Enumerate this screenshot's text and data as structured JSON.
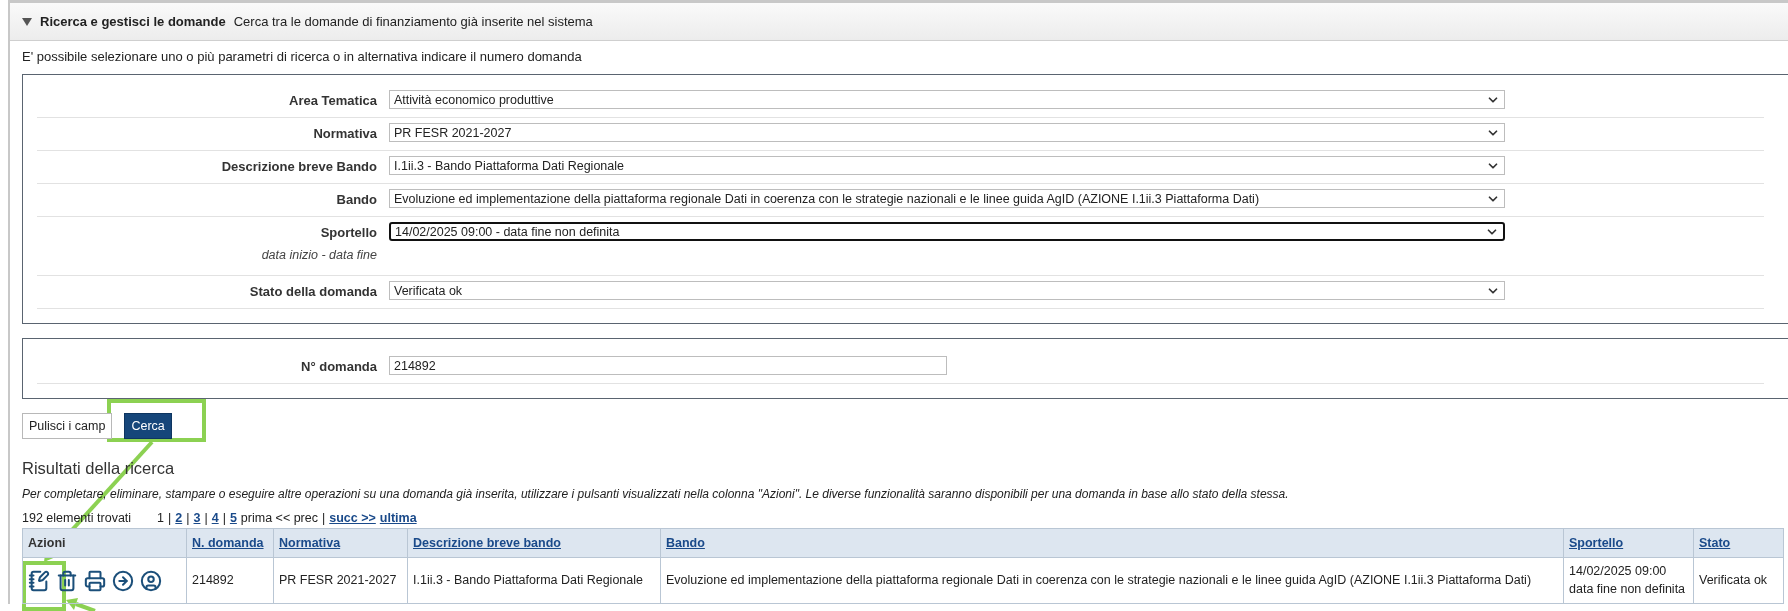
{
  "header": {
    "title": "Ricerca e gestisci le domande",
    "subtitle": "Cerca tra le domande di finanziamento già inserite nel sistema",
    "expanded": true
  },
  "intro": "E' possibile selezionare uno o più parametri di ricerca o in alternativa indicare il numero domanda",
  "filters": [
    {
      "label": "Area Tematica",
      "value": "Attività economico produttive",
      "focused": false
    },
    {
      "label": "Normativa",
      "value": "PR FESR 2021-2027",
      "focused": false
    },
    {
      "label": "Descrizione breve Bando",
      "value": "I.1ii.3 - Bando Piattaforma Dati Regionale",
      "focused": false
    },
    {
      "label": "Bando",
      "value": "Evoluzione ed implementazione della piattaforma regionale Dati in coerenza con le strategie nazionali e le linee guida AgID (AZIONE I.1ii.3 Piattaforma Dati)",
      "focused": false
    },
    {
      "label": "Sportello",
      "hint": "data inizio - data fine",
      "value": "14/02/2025 09:00 - data fine non definita",
      "focused": true
    },
    {
      "label": "Stato della domanda",
      "value": "Verificata ok",
      "focused": false
    }
  ],
  "number_field": {
    "label": "N° domanda",
    "value": "214892"
  },
  "buttons": [
    {
      "label": "Pulisci i camp",
      "kind": "plain"
    },
    {
      "label": "Cerca",
      "kind": "primary"
    }
  ],
  "results": {
    "title": "Risultati della ricerca",
    "note": "Per completare, eliminare, stampare o eseguire altre operazioni su una domanda già inserita, utilizzare i pulsanti visualizzati nella colonna \"Azioni\". Le diverse funzionalità saranno disponibili per una domanda in base allo stato della stessa.",
    "count": "192 elementi trovati",
    "pager": [
      {
        "kind": "page",
        "label": "1",
        "selected": true
      },
      {
        "kind": "sep",
        "label": "|"
      },
      {
        "kind": "page",
        "label": "2",
        "selected": false
      },
      {
        "kind": "sep",
        "label": "|"
      },
      {
        "kind": "page",
        "label": "3",
        "selected": false
      },
      {
        "kind": "sep",
        "label": "|"
      },
      {
        "kind": "page",
        "label": "4",
        "selected": false
      },
      {
        "kind": "sep",
        "label": "|"
      },
      {
        "kind": "page",
        "label": "5",
        "selected": false
      },
      {
        "kind": "text",
        "label": "prima << prec"
      },
      {
        "kind": "sep",
        "label": "|"
      },
      {
        "kind": "link",
        "label": "succ >>"
      },
      {
        "kind": "link",
        "label": "ultima"
      }
    ],
    "actions_header": "Azioni",
    "columns": [
      "N. domanda",
      "Normativa",
      "Descrizione breve bando",
      "Bando",
      "Sportello",
      "Stato"
    ],
    "rows": [
      {
        "cells": [
          "214892",
          "PR FESR 2021-2027",
          "I.1ii.3 - Bando Piattaforma Dati Regionale",
          "Evoluzione ed implementazione della piattaforma regionale Dati in coerenza con le strategie nazionali e le linee guida AgID (AZIONE I.1ii.3 Piattaforma Dati)",
          "14/02/2025 09:00 data fine non definita",
          "Verificata ok"
        ]
      }
    ]
  }
}
